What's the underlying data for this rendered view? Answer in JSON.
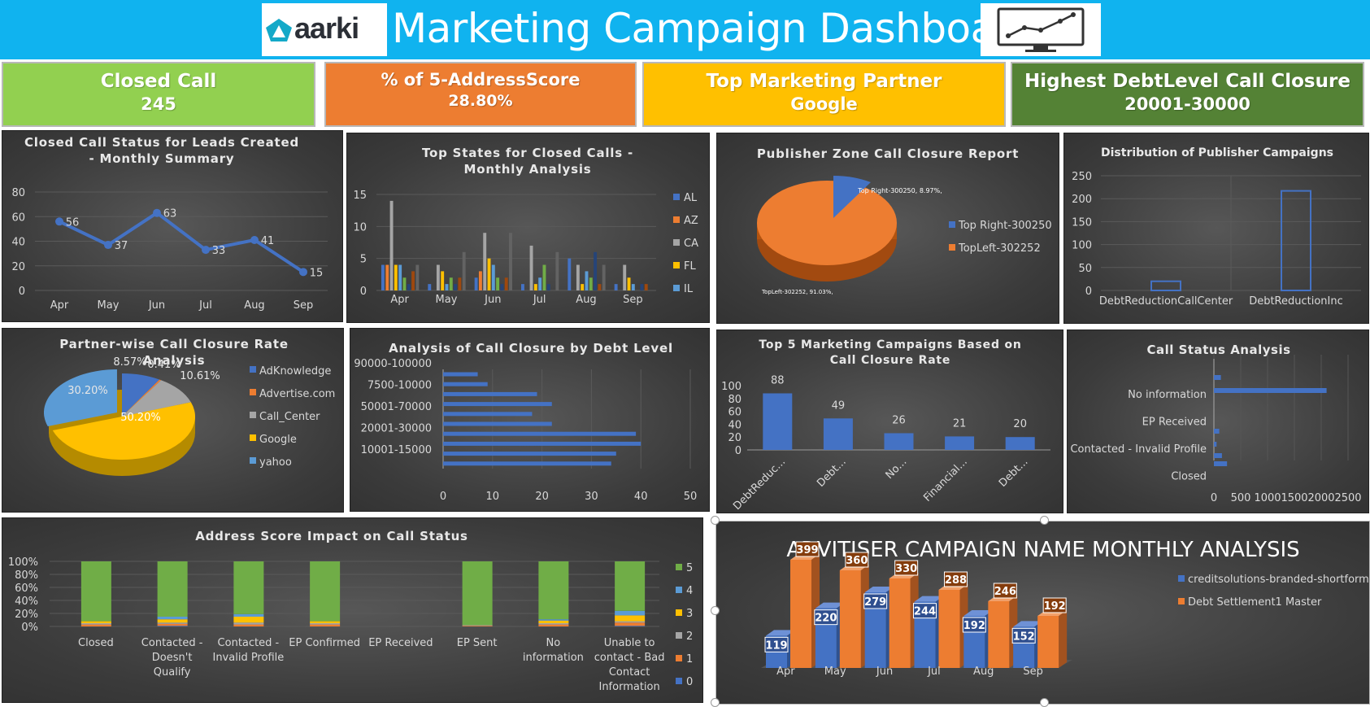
{
  "header": {
    "logo_text": "aarki",
    "title": "Marketing Campaign Dashboard"
  },
  "kpis": [
    {
      "label": "Closed Call",
      "value": "245",
      "color": "#92d050"
    },
    {
      "label": "% of 5-AddressScore",
      "value": "28.80%",
      "color": "#ed7d31"
    },
    {
      "label": "Top Marketing Partner",
      "value": "Google",
      "color": "#ffc000"
    },
    {
      "label": "Highest DebtLevel Call Closure",
      "value": "20001-30000",
      "color": "#548235"
    }
  ],
  "colors": {
    "blue": "#4472c4",
    "orange": "#ed7d31",
    "gray": "#a5a5a5",
    "gold": "#ffc000",
    "lightblue": "#5b9bd5",
    "green": "#70ad47"
  },
  "chart_data": [
    {
      "id": "closed-call-status",
      "type": "line",
      "title": "Closed Call Status for Leads Created - Monthly Summary",
      "categories": [
        "Apr",
        "May",
        "Jun",
        "Jul",
        "Aug",
        "Sep"
      ],
      "values": [
        56,
        37,
        63,
        33,
        41,
        15
      ],
      "yticks": [
        "0",
        "20",
        "40",
        "60",
        "80"
      ],
      "ylim": [
        0,
        80
      ]
    },
    {
      "id": "top-states",
      "type": "bar",
      "title": "Top States for Closed Calls - Monthly Analysis",
      "categories": [
        "Apr",
        "May",
        "Jun",
        "Jul",
        "Aug",
        "Sep"
      ],
      "legend": [
        "AL",
        "AZ",
        "CA",
        "FL",
        "IL"
      ],
      "series_colors": [
        "#4472c4",
        "#ed7d31",
        "#a5a5a5",
        "#ffc000",
        "#5b9bd5",
        "#70ad47",
        "#264478",
        "#9e480e",
        "#636363",
        "#997300"
      ],
      "values": [
        [
          4,
          4,
          14,
          4,
          4,
          2,
          1,
          3,
          4,
          0
        ],
        [
          1,
          0,
          4,
          3,
          1,
          2,
          1,
          2,
          6,
          0
        ],
        [
          2,
          3,
          9,
          5,
          4,
          2,
          1,
          2,
          9,
          0
        ],
        [
          1,
          0,
          7,
          1,
          2,
          4,
          1,
          0,
          6,
          0
        ],
        [
          5,
          0,
          4,
          1,
          3,
          2,
          6,
          1,
          4,
          0
        ],
        [
          1,
          0,
          4,
          2,
          1,
          0,
          1,
          1,
          0,
          0
        ]
      ],
      "yticks": [
        "0",
        "5",
        "10",
        "15"
      ],
      "ylim": [
        0,
        15
      ]
    },
    {
      "id": "publisher-zone",
      "type": "pie",
      "title": "Publisher Zone Call Closure Report",
      "labels": [
        "Top Right-300250",
        "TopLeft-302252"
      ],
      "values": [
        8.97,
        91.03
      ],
      "data_labels": [
        "Top Right-300250, 8.97%,",
        "TopLeft-302252, 91.03%,"
      ]
    },
    {
      "id": "publisher-campaigns",
      "type": "bar",
      "title": "Distribution of Publisher Campaigns",
      "categories": [
        "DebtReductionCallCenter",
        "DebtReductionInc"
      ],
      "values": [
        20,
        217
      ],
      "yticks": [
        "0",
        "50",
        "100",
        "150",
        "200",
        "250"
      ],
      "ylim": [
        0,
        250
      ]
    },
    {
      "id": "partner-closure",
      "type": "pie",
      "title": "Partner-wise Call Closure Rate Analysis",
      "labels": [
        "AdKnowledge",
        "Advertise.com",
        "Call_Center",
        "Google",
        "yahoo"
      ],
      "values": [
        8.57,
        0.41,
        10.61,
        50.2,
        30.2
      ],
      "data_labels": [
        "8.57%",
        "0.41%",
        "10.61%",
        "50.20%",
        "30.20%"
      ]
    },
    {
      "id": "debt-level",
      "type": "bar",
      "title": "Analysis of Call Closure by Debt Level",
      "orientation": "horizontal",
      "categories_visible": [
        "90000-100000",
        "7500-10000",
        "50001-70000",
        "20001-30000",
        "10001-15000"
      ],
      "values": [
        7,
        9,
        19,
        22,
        18,
        22,
        39,
        40,
        35,
        34
      ],
      "xticks": [
        "0",
        "10",
        "20",
        "30",
        "40",
        "50"
      ],
      "xlim": [
        0,
        50
      ]
    },
    {
      "id": "top5-campaigns",
      "type": "bar",
      "title": "Top 5 Marketing Campaigns Based on Call Closure Rate",
      "categories": [
        "DebtReduc...",
        "Debt...",
        "No...",
        "Financial...",
        "Debt..."
      ],
      "values": [
        88,
        49,
        26,
        21,
        20
      ],
      "yticks": [
        "0",
        "20",
        "40",
        "60",
        "80",
        "100"
      ],
      "ylim": [
        0,
        100
      ]
    },
    {
      "id": "call-status",
      "type": "bar",
      "title": "Call Status Analysis",
      "orientation": "horizontal",
      "categories_visible": [
        "No information",
        "EP Received",
        "Contacted - Invalid Profile",
        "Closed"
      ],
      "values": [
        130,
        2100,
        0,
        0,
        100,
        50,
        150,
        245
      ],
      "xticks": [
        "0",
        "500",
        "1000",
        "1500",
        "2000",
        "2500"
      ],
      "xlim": [
        0,
        2500
      ]
    },
    {
      "id": "address-score",
      "type": "bar",
      "stacked_percent": true,
      "title": "Address Score Impact on Call Status",
      "categories": [
        "Closed",
        "Contacted - Doesn't Qualify",
        "Contacted - Invalid Profile",
        "EP Confirmed",
        "EP Received",
        "EP Sent",
        "No information",
        "Unable to contact - Bad Contact Information"
      ],
      "category_lines": [
        [
          "Closed"
        ],
        [
          "Contacted -",
          "Doesn't",
          "Qualify"
        ],
        [
          "Contacted -",
          "Invalid Profile"
        ],
        [
          "EP Confirmed"
        ],
        [
          "EP Received"
        ],
        [
          "EP Sent"
        ],
        [
          "No",
          "information"
        ],
        [
          "Unable to",
          "contact - Bad",
          "Contact",
          "Information"
        ]
      ],
      "legend": [
        "5",
        "4",
        "3",
        "2",
        "1",
        "0"
      ],
      "series": [
        {
          "name": "0",
          "values": [
            0,
            1,
            0,
            0,
            0,
            0,
            0,
            1
          ]
        },
        {
          "name": "1",
          "values": [
            3,
            3,
            3,
            3,
            0,
            1,
            3,
            5
          ]
        },
        {
          "name": "2",
          "values": [
            2,
            2,
            3,
            2,
            0,
            1,
            2,
            2
          ]
        },
        {
          "name": "3",
          "values": [
            3,
            5,
            9,
            3,
            0,
            0,
            4,
            9
          ]
        },
        {
          "name": "4",
          "values": [
            0,
            4,
            4,
            0,
            0,
            0,
            2,
            7
          ]
        },
        {
          "name": "5",
          "values": [
            92,
            85,
            81,
            92,
            0,
            98,
            89,
            76
          ]
        }
      ],
      "yticks": [
        "0%",
        "20%",
        "40%",
        "60%",
        "80%",
        "100%"
      ]
    },
    {
      "id": "advertiser-monthly",
      "type": "bar",
      "title": "ADVITISER CAMPAIGN NAME MONTHLY ANALYSIS",
      "categories": [
        "Apr",
        "May",
        "Jun",
        "Jul",
        "Aug",
        "Sep"
      ],
      "series": [
        {
          "name": "creditsolutions-branded-shortform",
          "values": [
            119,
            220,
            279,
            244,
            192,
            152
          ]
        },
        {
          "name": "Debt Settlement1 Master",
          "values": [
            399,
            360,
            330,
            288,
            246,
            192
          ]
        }
      ],
      "ylim": [
        0,
        420
      ]
    }
  ]
}
